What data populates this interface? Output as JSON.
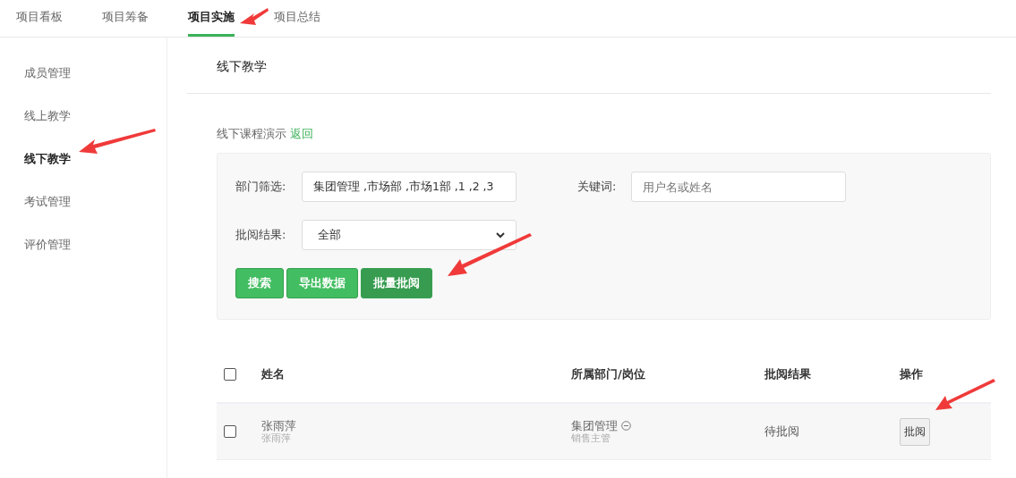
{
  "tabs": [
    {
      "label": "项目看板",
      "selected": false
    },
    {
      "label": "项目筹备",
      "selected": false
    },
    {
      "label": "项目实施",
      "selected": true
    },
    {
      "label": "项目总结",
      "selected": false
    }
  ],
  "sidebar": {
    "items": [
      {
        "label": "成员管理",
        "selected": false
      },
      {
        "label": "线上教学",
        "selected": false
      },
      {
        "label": "线下教学",
        "selected": true
      },
      {
        "label": "考试管理",
        "selected": false
      },
      {
        "label": "评价管理",
        "selected": false
      }
    ]
  },
  "page_title": "线下教学",
  "breadcrumb": {
    "text": "线下课程演示",
    "link": "返回"
  },
  "filters": {
    "department": {
      "label": "部门筛选:",
      "value": "集团管理 ,市场部 ,市场1部 ,1 ,2 ,3"
    },
    "keyword": {
      "label": "关键词:",
      "placeholder": "用户名或姓名"
    },
    "result": {
      "label": "批阅结果:",
      "value": "全部"
    },
    "buttons": [
      {
        "label": "搜索",
        "kind": "normal"
      },
      {
        "label": "导出数据",
        "kind": "normal"
      },
      {
        "label": "批量批阅",
        "kind": "dark"
      }
    ]
  },
  "table": {
    "select_all_checked": false,
    "columns": [
      "姓名",
      "所属部门/岗位",
      "批阅结果",
      "操作"
    ],
    "rows": [
      {
        "checked": false,
        "name": "张雨萍",
        "username": "张雨萍",
        "department": "集团管理",
        "position": "销售主管",
        "result": "待批阅",
        "action": "批阅"
      }
    ]
  }
}
